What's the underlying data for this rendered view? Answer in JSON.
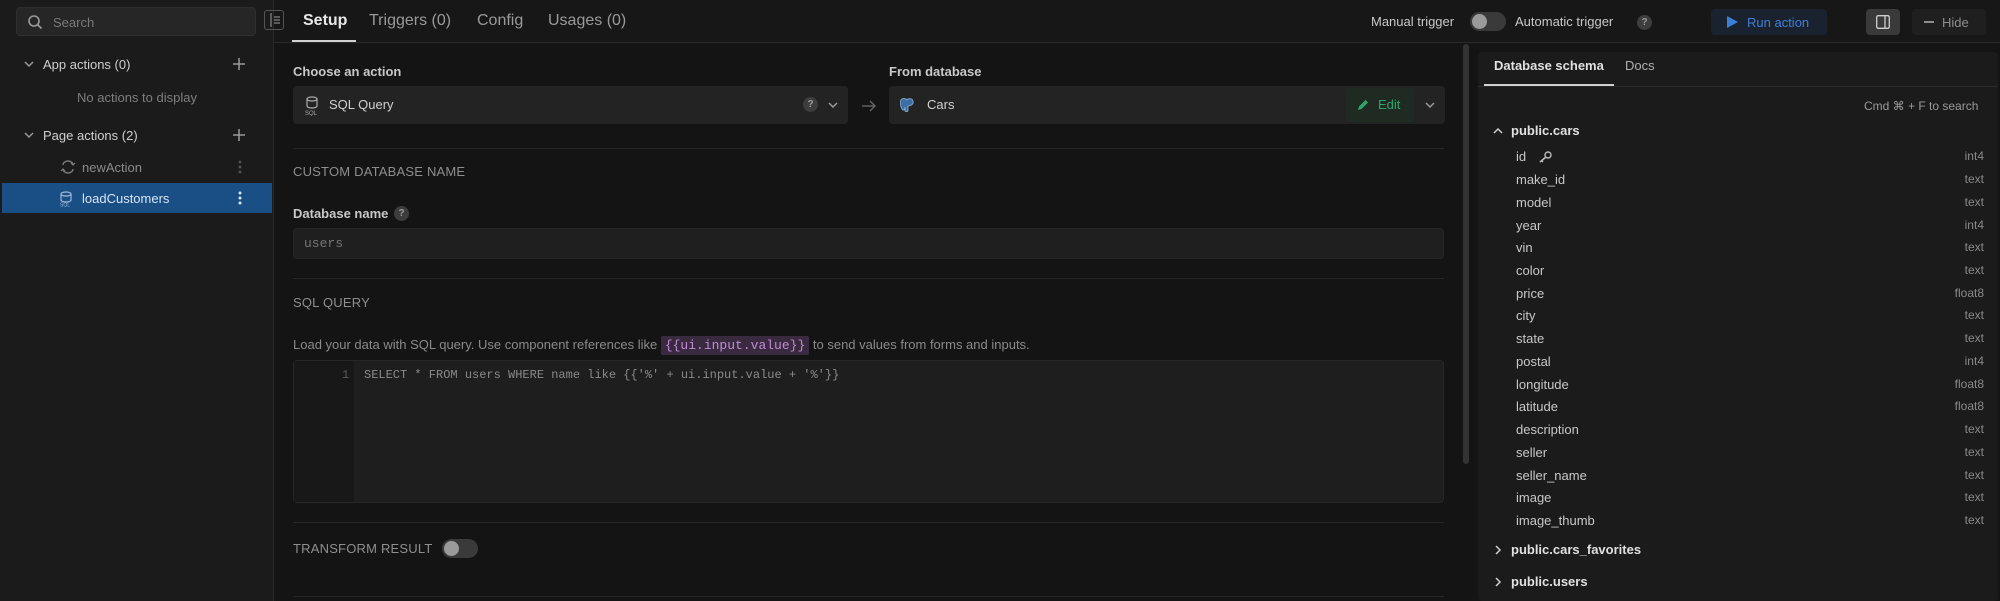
{
  "search": {
    "placeholder": "Search"
  },
  "sidebar": {
    "app_actions_label": "App actions (0)",
    "no_actions_text": "No actions to display",
    "page_actions_label": "Page actions (2)",
    "actions": [
      {
        "label": "newAction",
        "icon": "loop-icon",
        "selected": false
      },
      {
        "label": "loadCustomers",
        "icon": "sql-db-icon",
        "selected": true
      }
    ]
  },
  "tabs": {
    "setup": "Setup",
    "triggers": "Triggers (0)",
    "config": "Config",
    "usages": "Usages (0)"
  },
  "toolbar": {
    "manual_trigger": "Manual trigger",
    "automatic_trigger": "Automatic trigger",
    "help": "?",
    "run_action": "Run action",
    "hide": "Hide"
  },
  "setup": {
    "choose_action_label": "Choose an action",
    "action_value": "SQL Query",
    "from_database_label": "From database",
    "database_value": "Cars",
    "edit_label": "Edit",
    "custom_db_section": "CUSTOM DATABASE NAME",
    "db_name_label": "Database name",
    "db_name_placeholder": "users",
    "sql_section": "SQL QUERY",
    "help_prefix": "Load your data with SQL query. Use component references like",
    "help_code": "{{ui.input.value}}",
    "help_suffix": "to send values from forms and inputs.",
    "line_number": "1",
    "query": "SELECT * FROM users WHERE name like {{'%' + ui.input.value + '%'}}",
    "transform_section": "TRANSFORM RESULT"
  },
  "schema_panel": {
    "tab_schema": "Database schema",
    "tab_docs": "Docs",
    "search_hint": "Cmd ⌘ + F to search",
    "tables": [
      {
        "name": "public.cars",
        "expanded": true,
        "columns": [
          {
            "name": "id",
            "type": "int4",
            "key": true
          },
          {
            "name": "make_id",
            "type": "text"
          },
          {
            "name": "model",
            "type": "text"
          },
          {
            "name": "year",
            "type": "int4"
          },
          {
            "name": "vin",
            "type": "text"
          },
          {
            "name": "color",
            "type": "text"
          },
          {
            "name": "price",
            "type": "float8"
          },
          {
            "name": "city",
            "type": "text"
          },
          {
            "name": "state",
            "type": "text"
          },
          {
            "name": "postal",
            "type": "int4"
          },
          {
            "name": "longitude",
            "type": "float8"
          },
          {
            "name": "latitude",
            "type": "float8"
          },
          {
            "name": "description",
            "type": "text"
          },
          {
            "name": "seller",
            "type": "text"
          },
          {
            "name": "seller_name",
            "type": "text"
          },
          {
            "name": "image",
            "type": "text"
          },
          {
            "name": "image_thumb",
            "type": "text"
          }
        ]
      },
      {
        "name": "public.cars_favorites",
        "expanded": false
      },
      {
        "name": "public.users",
        "expanded": false
      }
    ]
  },
  "colors": {
    "accent": "#3d7fd6",
    "selected_bg": "#1a4f86",
    "edit_green": "#2fa56a",
    "code_purple": "#c08ad6"
  }
}
